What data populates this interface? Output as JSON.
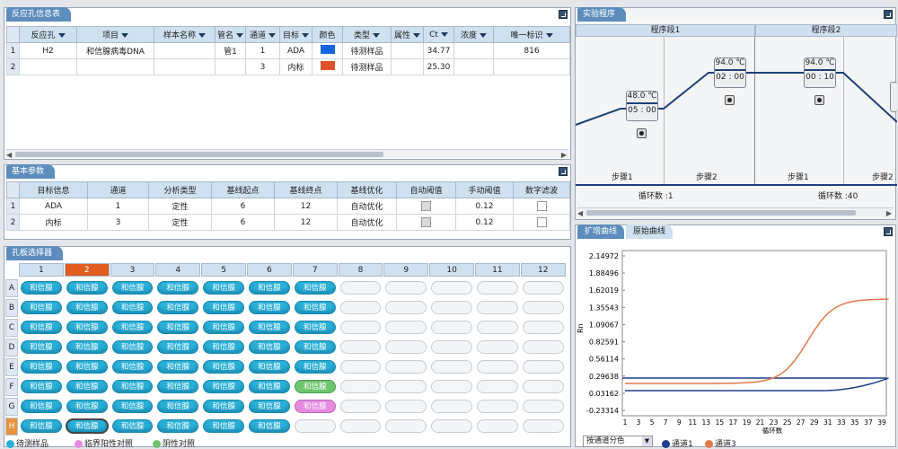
{
  "reaction": {
    "title": "反应孔信息表",
    "headers": [
      "反应孔",
      "项目",
      "样本名称",
      "管名",
      "通道",
      "目标",
      "颜色",
      "类型",
      "属性",
      "Ct",
      "浓度",
      "唯一标识"
    ],
    "rows": [
      {
        "num": "1",
        "well": "H2",
        "project": "和信腺病毒DNA",
        "sample": "",
        "tube": "管1",
        "channel": "1",
        "target": "ADA",
        "color": "#1565e0",
        "type": "待测样品",
        "attr": "",
        "ct": "34.77",
        "conc": "",
        "uid": "816"
      },
      {
        "num": "2",
        "well": "",
        "project": "",
        "sample": "",
        "tube": "",
        "channel": "3",
        "target": "内标",
        "color": "#e0502a",
        "type": "待测样品",
        "attr": "",
        "ct": "25.30",
        "conc": "",
        "uid": ""
      }
    ]
  },
  "basic": {
    "title": "基本参数",
    "headers": [
      "目标信息",
      "通道",
      "分析类型",
      "基线起点",
      "基线终点",
      "基线优化",
      "自动阈值",
      "手动阈值",
      "数字滤波"
    ],
    "rows": [
      {
        "num": "1",
        "target": "ADA",
        "channel": "1",
        "type": "定性",
        "start": "6",
        "end": "12",
        "opt": "自动优化",
        "threshold": "0.12"
      },
      {
        "num": "2",
        "target": "内标",
        "channel": "3",
        "type": "定性",
        "start": "6",
        "end": "12",
        "opt": "自动优化",
        "threshold": "0.12"
      }
    ]
  },
  "plate": {
    "title": "孔板选择器",
    "cols": [
      "1",
      "2",
      "3",
      "4",
      "5",
      "6",
      "7",
      "8",
      "9",
      "10",
      "11",
      "12"
    ],
    "rows": [
      "A",
      "B",
      "C",
      "D",
      "E",
      "F",
      "G",
      "H"
    ],
    "well_label": "和信腺",
    "legend": {
      "sample": "待测样品",
      "pos": "临界阳性对照",
      "neg": "阴性对照"
    }
  },
  "program": {
    "title": "实验程序",
    "seg1": "程序段1",
    "seg2": "程序段2",
    "s1": {
      "temp": "48.0 ℃",
      "time": "05 : 00"
    },
    "s2": {
      "temp": "94.0 ℃",
      "time": "02 : 00"
    },
    "s3": {
      "temp": "94.0 ℃",
      "time": "00 : 10"
    },
    "step1": "步骤1",
    "step2": "步骤2",
    "step3": "步骤1",
    "step4": "步骤2",
    "cycle1": "循环数 :1",
    "cycle2": "循环数 :40"
  },
  "curve": {
    "tab_amp": "扩增曲线",
    "tab_raw": "原始曲线",
    "ylabel": "Rn",
    "xlabel": "循环数",
    "yticks": [
      "2.14972",
      "1.88496",
      "1.62019",
      "1.35543",
      "1.09067",
      "0.82591",
      "0.56114",
      "0.29638",
      "0.03162",
      "-0.23314"
    ],
    "xticks": [
      "1",
      "3",
      "5",
      "7",
      "9",
      "11",
      "13",
      "15",
      "17",
      "19",
      "21",
      "23",
      "25",
      "27",
      "29",
      "31",
      "33",
      "35",
      "37",
      "39"
    ],
    "select_label": "按通道分色",
    "ch1": "通道1",
    "ch3": "通道3",
    "ch1_color": "#1e3f8a",
    "ch3_color": "#e07a4a"
  }
}
